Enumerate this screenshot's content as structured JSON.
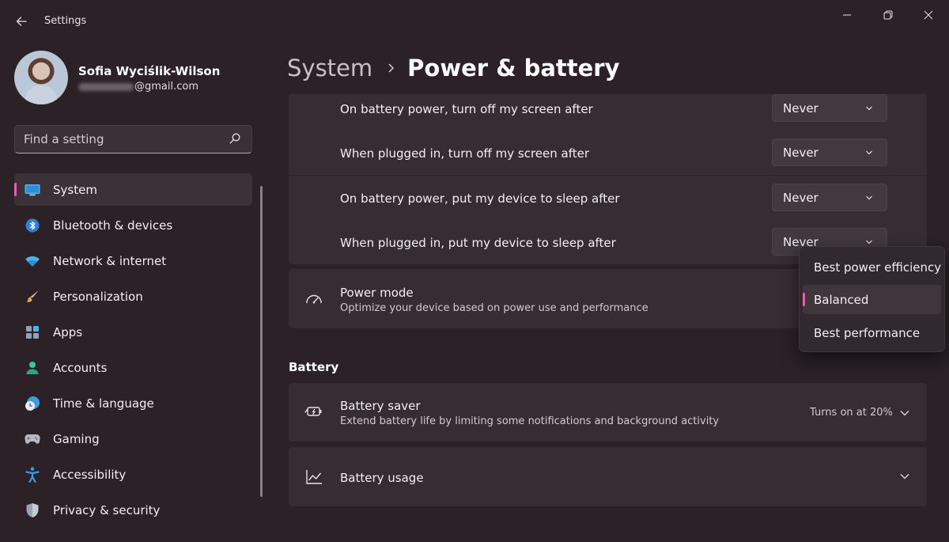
{
  "app": {
    "title": "Settings"
  },
  "user": {
    "name": "Sofia Wyciślik-Wilson",
    "email_domain": "@gmail.com"
  },
  "search": {
    "placeholder": "Find a setting"
  },
  "nav": {
    "items": [
      {
        "label": "System",
        "icon": "system-icon",
        "active": true
      },
      {
        "label": "Bluetooth & devices",
        "icon": "bluetooth-icon"
      },
      {
        "label": "Network & internet",
        "icon": "network-icon"
      },
      {
        "label": "Personalization",
        "icon": "personalization-brush-icon"
      },
      {
        "label": "Apps",
        "icon": "apps-icon"
      },
      {
        "label": "Accounts",
        "icon": "accounts-icon"
      },
      {
        "label": "Time & language",
        "icon": "time-language-icon"
      },
      {
        "label": "Gaming",
        "icon": "gaming-icon"
      },
      {
        "label": "Accessibility",
        "icon": "accessibility-icon"
      },
      {
        "label": "Privacy & security",
        "icon": "shield-icon"
      }
    ]
  },
  "breadcrumb": {
    "parent": "System",
    "current": "Power & battery"
  },
  "screen_sleep": {
    "rows": [
      {
        "label": "On battery power, turn off my screen after",
        "value": "Never"
      },
      {
        "label": "When plugged in, turn off my screen after",
        "value": "Never"
      },
      {
        "label": "On battery power, put my device to sleep after",
        "value": "Never"
      },
      {
        "label": "When plugged in, put my device to sleep after",
        "value": "Never"
      }
    ]
  },
  "power_mode": {
    "title": "Power mode",
    "subtitle": "Optimize your device based on power use and performance",
    "options": [
      "Best power efficiency",
      "Balanced",
      "Best performance"
    ],
    "selected": "Balanced"
  },
  "battery": {
    "section_title": "Battery",
    "saver": {
      "title": "Battery saver",
      "subtitle": "Extend battery life by limiting some notifications and background activity",
      "status": "Turns on at 20%"
    },
    "usage": {
      "title": "Battery usage"
    }
  },
  "colors": {
    "accent": "#ea5cb5",
    "background": "#2b2127",
    "card": "#372c33"
  }
}
